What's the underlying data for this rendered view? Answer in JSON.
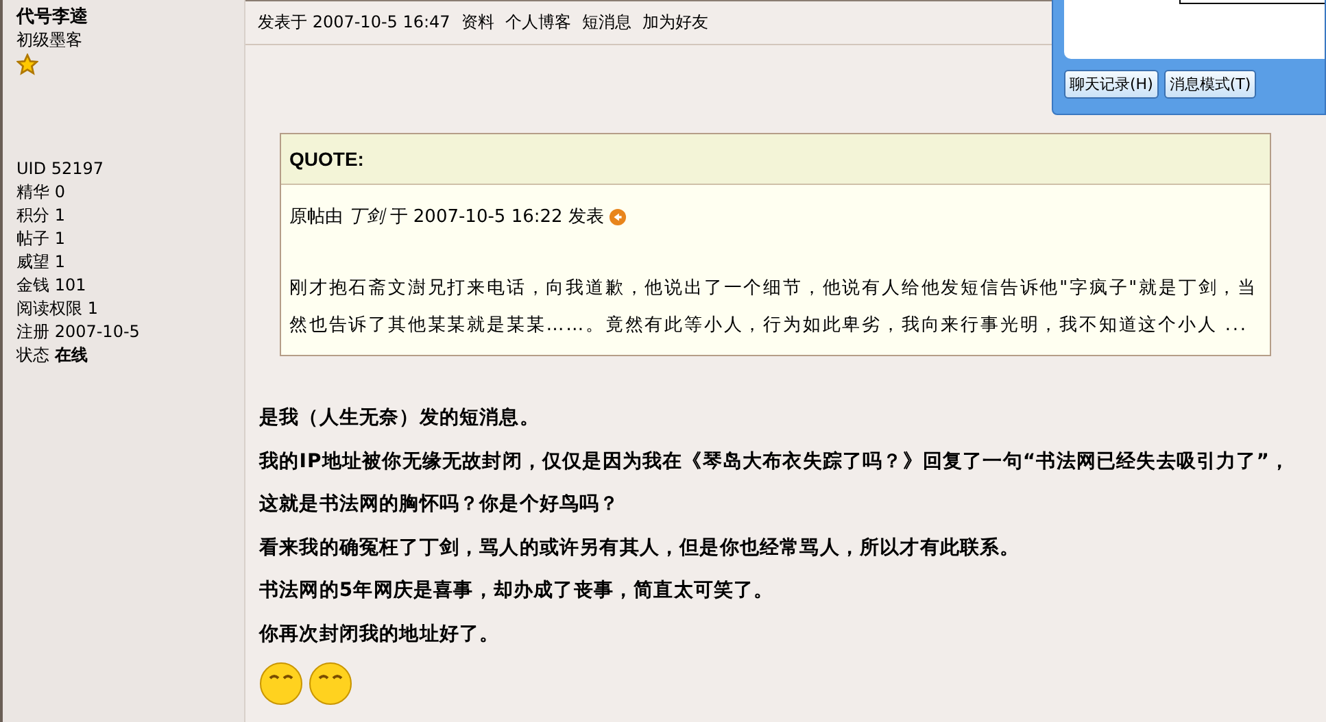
{
  "author": {
    "name": "代号李逵",
    "rank": "初级墨客",
    "stats": [
      "UID 52197",
      "精华 0",
      "积分 1",
      "帖子 1",
      "威望 1",
      "金钱 101",
      "阅读权限 1",
      "注册 2007-10-5",
      "状态 **在线**"
    ]
  },
  "post_header": {
    "posted": "发表于 2007-10-5 16:47",
    "links": [
      "资料",
      "个人博客",
      "短消息",
      "加为好友"
    ]
  },
  "quote": {
    "title": "QUOTE:",
    "source": "原帖由 *丁剑* 于 2007-10-5 16:22 发表",
    "text": "刚才抱石斋文澍兄打来电话，向我道歉，他说出了一个细节，他说有人给他发短信告诉他\"字疯子\"就是丁剑，当然也告诉了其他某某就是某某……。竟然有此等小人，行为如此卑劣，我向来行事光明，我不知道这个小人 ..."
  },
  "message": [
    "是我（人生无奈）发的短消息。",
    "我的IP地址被你无缘无故封闭，仅仅是因为我在《琴岛大布衣失踪了吗？》回复了一句“书法网已经失去吸引力了”，这就是书法网的胸怀吗？你是个好鸟吗？",
    "看来我的确冤枉了丁剑，骂人的或许另有其人，但是你也经常骂人，所以才有此联系。",
    "书法网的5年网庆是喜事，却办成了丧事，简直太可笑了。",
    "你再次封闭我的地址好了。"
  ],
  "emoticons": [
    {
      "kind": "smile"
    },
    {
      "kind": "smile"
    }
  ],
  "chat_window": {
    "buttons": [
      "聊天记录(H)",
      "消息模式(T)"
    ]
  }
}
